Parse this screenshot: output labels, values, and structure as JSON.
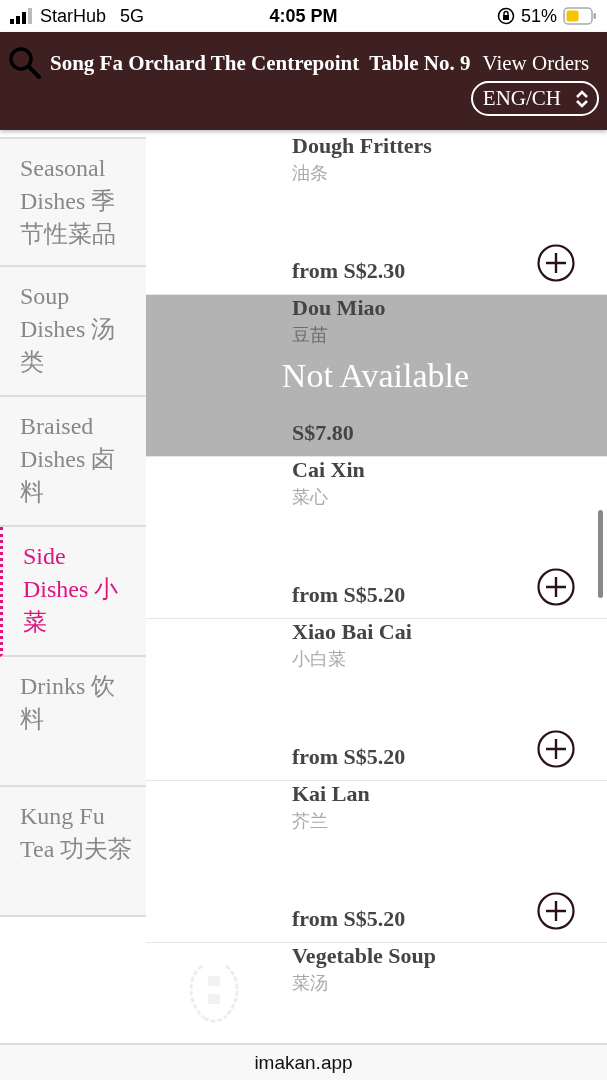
{
  "status_bar": {
    "carrier": "StarHub",
    "network": "5G",
    "time": "4:05 PM",
    "battery": "51%"
  },
  "header": {
    "restaurant": "Song Fa Orchard The Centrepoint",
    "table": "Table No. 9",
    "view_orders": "View Orders",
    "language": "ENG/CH"
  },
  "categories": [
    {
      "label": "Seasonal Dishes 季节性菜品",
      "selected": false
    },
    {
      "label": "Soup Dishes 汤类",
      "selected": false
    },
    {
      "label": "Braised Dishes 卤料",
      "selected": false
    },
    {
      "label": "Side Dishes 小菜",
      "selected": true
    },
    {
      "label": "Drinks 饮料",
      "selected": false
    },
    {
      "label": "Kung Fu Tea 功夫茶",
      "selected": false
    }
  ],
  "items": [
    {
      "name": "Dough Fritters",
      "name_zh": "油条",
      "price": "from S$2.30",
      "available": true
    },
    {
      "name": "Dou Miao",
      "name_zh": "豆苗",
      "price": "S$7.80",
      "available": false,
      "notice": "Not Available"
    },
    {
      "name": "Cai Xin",
      "name_zh": "菜心",
      "price": "from S$5.20",
      "available": true
    },
    {
      "name": "Xiao Bai Cai",
      "name_zh": "小白菜",
      "price": "from S$5.20",
      "available": true
    },
    {
      "name": "Kai Lan",
      "name_zh": "芥兰",
      "price": "from S$5.20",
      "available": true
    },
    {
      "name": "Vegetable Soup",
      "name_zh": "菜汤",
      "available": true
    }
  ],
  "address_bar": {
    "url": "imakan.app"
  }
}
